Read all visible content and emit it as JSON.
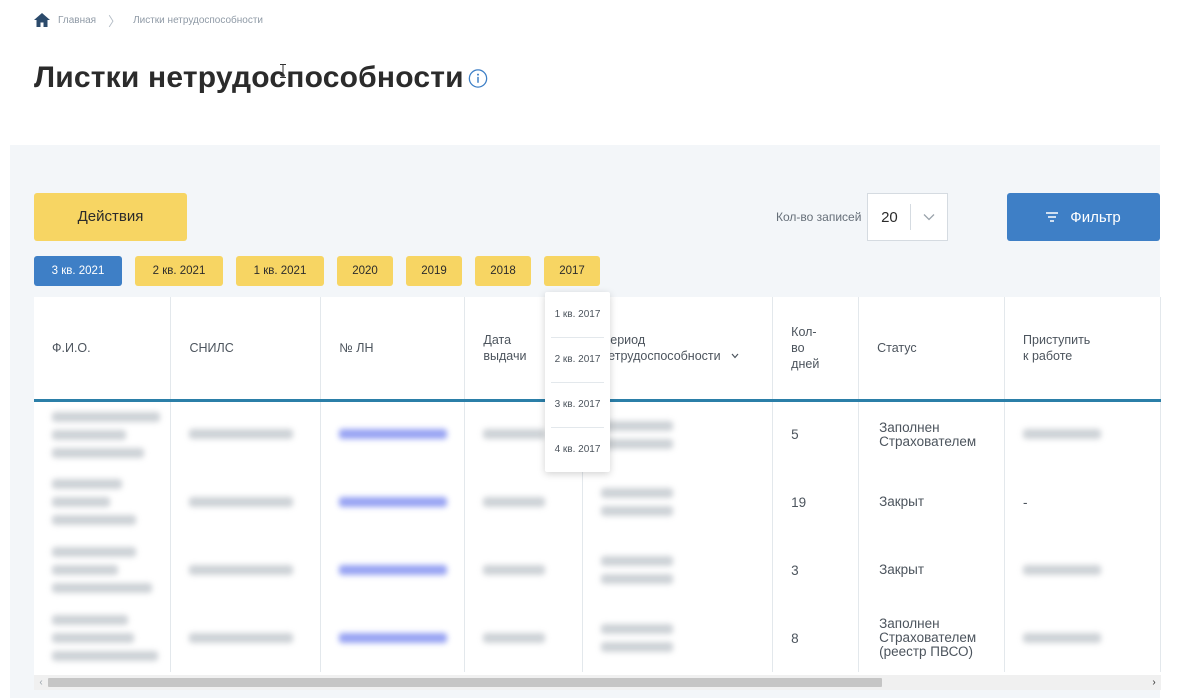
{
  "breadcrumb": {
    "home_icon": "home-icon",
    "items": [
      "Главная",
      "Листки нетрудоспособности"
    ],
    "separator": "〉"
  },
  "page": {
    "title": "Листки нетрудоспособности",
    "info_icon": "info-circle-icon"
  },
  "toolbar": {
    "actions_label": "Действия",
    "records_label": "Кол-во записей",
    "records_value": "20",
    "filter_label": "Фильтр",
    "filter_icon": "filter-lines-icon"
  },
  "period_tabs": [
    {
      "label": "3 кв. 2021",
      "active": true
    },
    {
      "label": "2 кв. 2021",
      "active": false
    },
    {
      "label": "1 кв. 2021",
      "active": false
    },
    {
      "label": "2020",
      "active": false
    },
    {
      "label": "2019",
      "active": false
    },
    {
      "label": "2018",
      "active": false
    },
    {
      "label": "2017",
      "active": false
    }
  ],
  "quarter_dropdown": [
    "1 кв. 2017",
    "2 кв. 2017",
    "3 кв. 2017",
    "4 кв. 2017"
  ],
  "table": {
    "columns": {
      "fio": "Ф.И.О.",
      "snils": "СНИЛС",
      "ln": "№ ЛН",
      "issue_date_1": "Дата",
      "issue_date_2": "выдачи",
      "period_1": "Период",
      "period_2": "нетрудоспособности",
      "days_1": "Кол-",
      "days_2": "во",
      "days_3": "дней",
      "status": "Статус",
      "start_1": "Приступить",
      "start_2": "к работе"
    },
    "rows": [
      {
        "days": "5",
        "status_1": "Заполнен",
        "status_2": "Страхователем",
        "status_3": "",
        "start": ""
      },
      {
        "days": "19",
        "status_1": "Закрыт",
        "status_2": "",
        "status_3": "",
        "start": "-"
      },
      {
        "days": "3",
        "status_1": "Закрыт",
        "status_2": "",
        "status_3": "",
        "start": ""
      },
      {
        "days": "8",
        "status_1": "Заполнен",
        "status_2": "Страхователем",
        "status_3": "(реестр ПВСО)",
        "start": ""
      }
    ]
  },
  "scrollbar": {
    "left_arrow": "‹",
    "right_arrow": "›"
  },
  "colors": {
    "accent_yellow": "#f7d563",
    "accent_blue": "#3e7fc6",
    "header_line": "#2b7fa8",
    "panel_bg": "#f3f6f9"
  }
}
